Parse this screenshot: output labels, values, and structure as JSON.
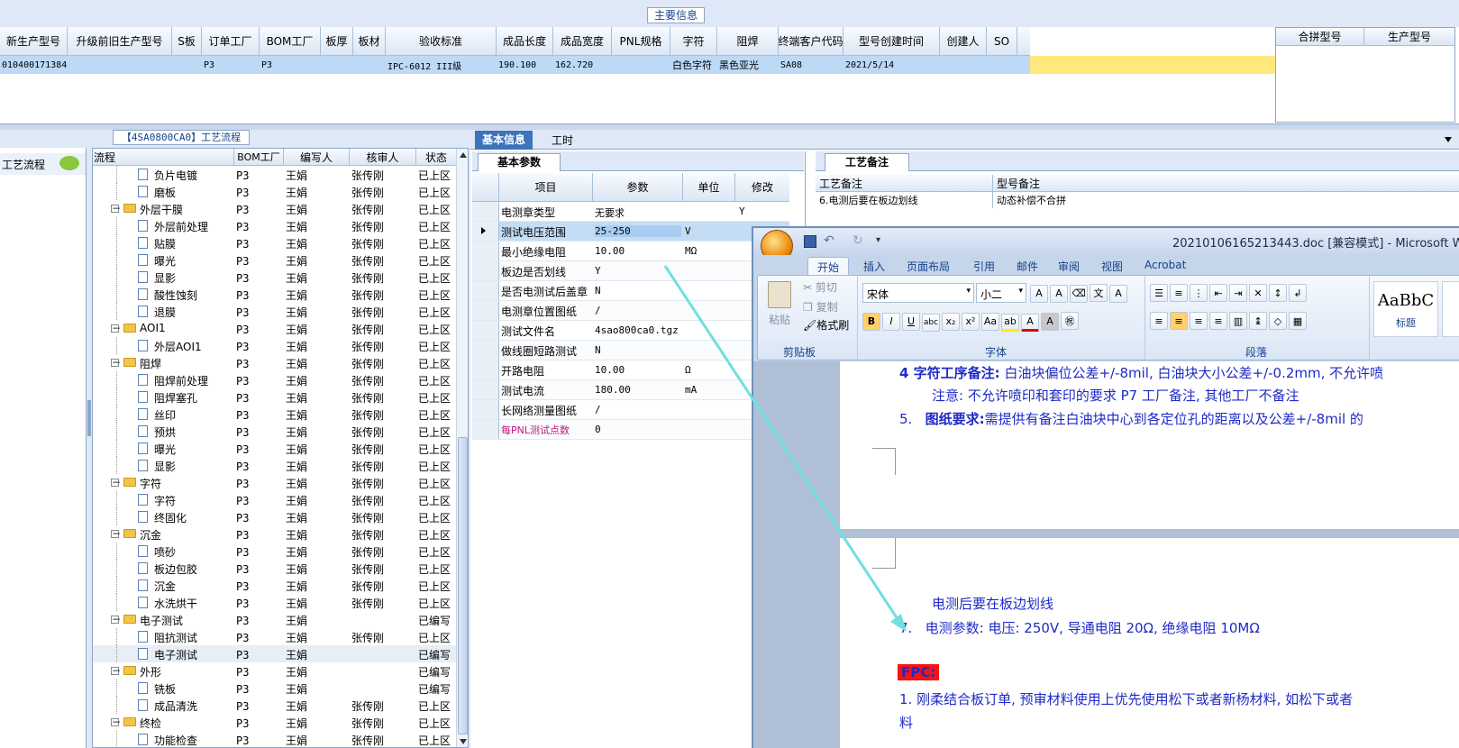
{
  "main_info_title": "主要信息",
  "main_grid": {
    "headers": [
      "新生产型号",
      "升级前旧生产型号",
      "S板",
      "订单工厂",
      "BOM工厂",
      "板厚",
      "板材",
      "验收标准",
      "成品长度",
      "成品宽度",
      "PNL规格",
      "字符",
      "阻焊",
      "终端客户代码",
      "型号创建时间",
      "创建人",
      "SO"
    ],
    "row": [
      "010400171384",
      "",
      "",
      "P3",
      "P3",
      "",
      "",
      "IPC-6012 III级",
      "190.100",
      "162.720",
      "",
      "白色字符",
      "黑色亚光",
      "SA08",
      "2021/5/14",
      "",
      ""
    ],
    "side_headers": [
      "合拼型号",
      "生产型号"
    ]
  },
  "process_panel": {
    "title": "【4SA0800CA0】工艺流程",
    "sidebar_label": "工艺流程",
    "headers": [
      "流程",
      "BOM工厂",
      "编写人",
      "核审人",
      "状态"
    ],
    "rows": [
      {
        "level": 2,
        "type": "doc",
        "name": "负片电镀",
        "bom": "P3",
        "writer": "王娟",
        "reviewer": "张传刚",
        "status": "已上区"
      },
      {
        "level": 2,
        "type": "doc",
        "name": "磨板",
        "bom": "P3",
        "writer": "王娟",
        "reviewer": "张传刚",
        "status": "已上区"
      },
      {
        "level": 1,
        "type": "folder",
        "name": "外层干膜",
        "bom": "P3",
        "writer": "王娟",
        "reviewer": "张传刚",
        "status": "已上区"
      },
      {
        "level": 2,
        "type": "doc",
        "name": "外层前处理",
        "bom": "P3",
        "writer": "王娟",
        "reviewer": "张传刚",
        "status": "已上区"
      },
      {
        "level": 2,
        "type": "doc",
        "name": "贴膜",
        "bom": "P3",
        "writer": "王娟",
        "reviewer": "张传刚",
        "status": "已上区"
      },
      {
        "level": 2,
        "type": "doc",
        "name": "曝光",
        "bom": "P3",
        "writer": "王娟",
        "reviewer": "张传刚",
        "status": "已上区"
      },
      {
        "level": 2,
        "type": "doc",
        "name": "显影",
        "bom": "P3",
        "writer": "王娟",
        "reviewer": "张传刚",
        "status": "已上区"
      },
      {
        "level": 2,
        "type": "doc",
        "name": "酸性蚀刻",
        "bom": "P3",
        "writer": "王娟",
        "reviewer": "张传刚",
        "status": "已上区"
      },
      {
        "level": 2,
        "type": "doc",
        "name": "退膜",
        "bom": "P3",
        "writer": "王娟",
        "reviewer": "张传刚",
        "status": "已上区"
      },
      {
        "level": 1,
        "type": "folder",
        "name": "AOI1",
        "bom": "P3",
        "writer": "王娟",
        "reviewer": "张传刚",
        "status": "已上区"
      },
      {
        "level": 2,
        "type": "doc",
        "name": "外层AOI1",
        "bom": "P3",
        "writer": "王娟",
        "reviewer": "张传刚",
        "status": "已上区"
      },
      {
        "level": 1,
        "type": "folder",
        "name": "阻焊",
        "bom": "P3",
        "writer": "王娟",
        "reviewer": "张传刚",
        "status": "已上区"
      },
      {
        "level": 2,
        "type": "doc",
        "name": "阻焊前处理",
        "bom": "P3",
        "writer": "王娟",
        "reviewer": "张传刚",
        "status": "已上区"
      },
      {
        "level": 2,
        "type": "doc",
        "name": "阻焊塞孔",
        "bom": "P3",
        "writer": "王娟",
        "reviewer": "张传刚",
        "status": "已上区"
      },
      {
        "level": 2,
        "type": "doc",
        "name": "丝印",
        "bom": "P3",
        "writer": "王娟",
        "reviewer": "张传刚",
        "status": "已上区"
      },
      {
        "level": 2,
        "type": "doc",
        "name": "预烘",
        "bom": "P3",
        "writer": "王娟",
        "reviewer": "张传刚",
        "status": "已上区"
      },
      {
        "level": 2,
        "type": "doc",
        "name": "曝光",
        "bom": "P3",
        "writer": "王娟",
        "reviewer": "张传刚",
        "status": "已上区"
      },
      {
        "level": 2,
        "type": "doc",
        "name": "显影",
        "bom": "P3",
        "writer": "王娟",
        "reviewer": "张传刚",
        "status": "已上区"
      },
      {
        "level": 1,
        "type": "folder",
        "name": "字符",
        "bom": "P3",
        "writer": "王娟",
        "reviewer": "张传刚",
        "status": "已上区"
      },
      {
        "level": 2,
        "type": "doc",
        "name": "字符",
        "bom": "P3",
        "writer": "王娟",
        "reviewer": "张传刚",
        "status": "已上区"
      },
      {
        "level": 2,
        "type": "doc",
        "name": "终固化",
        "bom": "P3",
        "writer": "王娟",
        "reviewer": "张传刚",
        "status": "已上区"
      },
      {
        "level": 1,
        "type": "folder",
        "name": "沉金",
        "bom": "P3",
        "writer": "王娟",
        "reviewer": "张传刚",
        "status": "已上区"
      },
      {
        "level": 2,
        "type": "doc",
        "name": "喷砂",
        "bom": "P3",
        "writer": "王娟",
        "reviewer": "张传刚",
        "status": "已上区"
      },
      {
        "level": 2,
        "type": "doc",
        "name": "板边包胶",
        "bom": "P3",
        "writer": "王娟",
        "reviewer": "张传刚",
        "status": "已上区"
      },
      {
        "level": 2,
        "type": "doc",
        "name": "沉金",
        "bom": "P3",
        "writer": "王娟",
        "reviewer": "张传刚",
        "status": "已上区"
      },
      {
        "level": 2,
        "type": "doc",
        "name": "水洗烘干",
        "bom": "P3",
        "writer": "王娟",
        "reviewer": "张传刚",
        "status": "已上区"
      },
      {
        "level": 1,
        "type": "folder",
        "name": "电子测试",
        "bom": "P3",
        "writer": "王娟",
        "reviewer": "",
        "status": "已编写"
      },
      {
        "level": 2,
        "type": "doc",
        "name": "阻抗测试",
        "bom": "P3",
        "writer": "王娟",
        "reviewer": "张传刚",
        "status": "已上区"
      },
      {
        "level": 2,
        "type": "doc",
        "name": "电子测试",
        "bom": "P3",
        "writer": "王娟",
        "reviewer": "",
        "status": "已编写",
        "selected": true
      },
      {
        "level": 1,
        "type": "folder",
        "name": "外形",
        "bom": "P3",
        "writer": "王娟",
        "reviewer": "",
        "status": "已编写"
      },
      {
        "level": 2,
        "type": "doc",
        "name": "铣板",
        "bom": "P3",
        "writer": "王娟",
        "reviewer": "",
        "status": "已编写"
      },
      {
        "level": 2,
        "type": "doc",
        "name": "成品清洗",
        "bom": "P3",
        "writer": "王娟",
        "reviewer": "张传刚",
        "status": "已上区"
      },
      {
        "level": 1,
        "type": "folder",
        "name": "终检",
        "bom": "P3",
        "writer": "王娟",
        "reviewer": "张传刚",
        "status": "已上区"
      },
      {
        "level": 2,
        "type": "doc",
        "name": "功能检查",
        "bom": "P3",
        "writer": "王娟",
        "reviewer": "张传刚",
        "status": "已上区"
      }
    ]
  },
  "info_tabs": {
    "basic": "基本信息",
    "hours": "工时"
  },
  "params": {
    "tab": "基本参数",
    "headers": [
      "项目",
      "参数",
      "单位",
      "修改"
    ],
    "rows": [
      {
        "item": "电测章类型",
        "value": "无要求",
        "unit": "",
        "mod": "Y"
      },
      {
        "item": "测试电压范围",
        "value": "25-250",
        "unit": "V",
        "mod": ""
      },
      {
        "item": "最小绝缘电阻",
        "value": "10.00",
        "unit": "MΩ",
        "mod": ""
      },
      {
        "item": "板边是否划线",
        "value": "Y",
        "unit": "",
        "mod": ""
      },
      {
        "item": "是否电测试后盖章",
        "value": "N",
        "unit": "",
        "mod": ""
      },
      {
        "item": "电测章位置图纸",
        "value": "/",
        "unit": "",
        "mod": ""
      },
      {
        "item": "测试文件名",
        "value": "4sao800ca0.tgz",
        "unit": "",
        "mod": ""
      },
      {
        "item": "做线圈短路测试",
        "value": "N",
        "unit": "",
        "mod": ""
      },
      {
        "item": "开路电阻",
        "value": "10.00",
        "unit": "Ω",
        "mod": ""
      },
      {
        "item": "测试电流",
        "value": "180.00",
        "unit": "mA",
        "mod": ""
      },
      {
        "item": "长网络测量图纸",
        "value": "/",
        "unit": "",
        "mod": ""
      },
      {
        "item": "每PNL测试点数",
        "value": "0",
        "unit": "",
        "mod": ""
      }
    ]
  },
  "remarks": {
    "tab": "工艺备注",
    "headers": [
      "工艺备注",
      "型号备注"
    ],
    "row": [
      "6.电测后要在板边划线",
      "动态补偿不合拼"
    ]
  },
  "word": {
    "title": "20210106165213443.doc [兼容模式] - Microsoft Word",
    "tabs": [
      "开始",
      "插入",
      "页面布局",
      "引用",
      "邮件",
      "审阅",
      "视图",
      "Acrobat"
    ],
    "clipboard": {
      "paste": "粘贴",
      "cut": "剪切",
      "copy": "复制",
      "format": "格式刷",
      "group": "剪贴板"
    },
    "font": {
      "name": "宋体",
      "size": "小二",
      "group": "字体"
    },
    "para_group": "段落",
    "style_preview": "AaBbC",
    "style_label": "标题",
    "doc_lines": {
      "l1_bold": "4 字符工序备注:",
      "l1_rest": "白油块偏位公差+/-8mil, 白油块大小公差+/-0.2mm, 不允许喷",
      "l2": "注意: 不允许喷印和套印的要求 P7 工厂备注, 其他工厂不备注",
      "l3_num": "5.",
      "l3_bold": "图纸要求:",
      "l3_rest": "需提供有备注白油块中心到各定位孔的距离以及公差+/-8mil 的",
      "l4": "电测后要在板边划线",
      "l5_num": "7.",
      "l5": "电测参数: 电压: 250V, 导通电阻 20Ω, 绝缘电阻 10MΩ",
      "fpc": "FPC:",
      "l6": "1. 刚柔结合板订单, 预审材料使用上优先使用松下或者新杨材料, 如松下或者",
      "l7": "料"
    }
  }
}
